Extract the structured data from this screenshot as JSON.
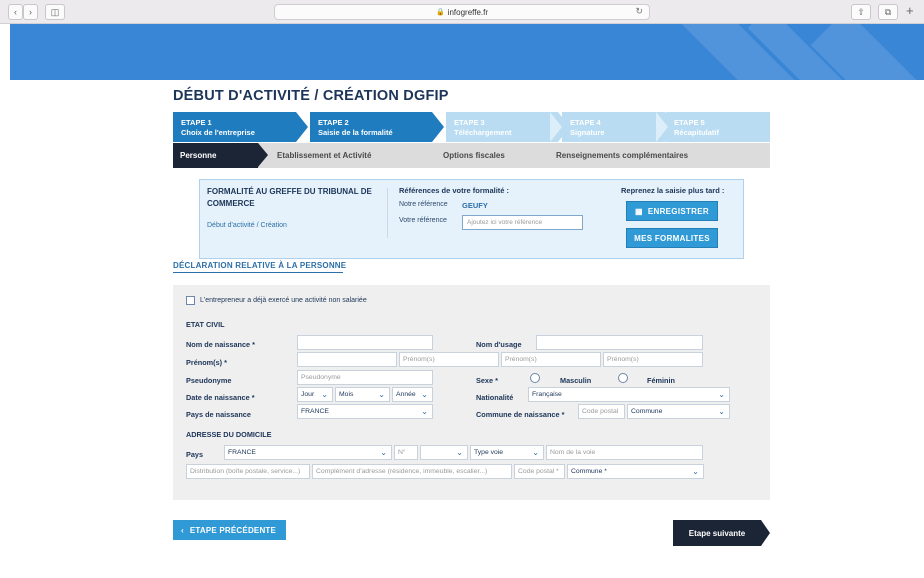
{
  "browser": {
    "url": "infogreffe.fr"
  },
  "page": {
    "title": "DÉBUT D'ACTIVITÉ / CRÉATION DGFIP"
  },
  "steps": [
    {
      "num": "ETAPE 1",
      "label": "Choix de l'entreprise",
      "state": "done"
    },
    {
      "num": "ETAPE 2",
      "label": "Saisie de la formalité",
      "state": "active"
    },
    {
      "num": "ETAPE 3",
      "label": "Téléchargement",
      "state": "todo"
    },
    {
      "num": "ETAPE 4",
      "label": "Signature",
      "state": "todo"
    },
    {
      "num": "ETAPE 5",
      "label": "Récapitulatif",
      "state": "todo"
    }
  ],
  "subtabs": [
    "Personne",
    "Etablissement et Activité",
    "Options fiscales",
    "Renseignements complémentaires"
  ],
  "formality": {
    "title": "FORMALITÉ AU GREFFE DU TRIBUNAL DE COMMERCE",
    "link": "Début d'activité / Création",
    "refs_title": "Références de votre formalité :",
    "our_ref_label": "Notre référence",
    "our_ref_value": "GEUFY",
    "your_ref_label": "Votre référence",
    "your_ref_placeholder": "Ajoutez ici votre référence",
    "resume_label": "Reprenez la saisie plus tard :",
    "save_button": "ENREGISTRER",
    "my_formalities_button": "MES FORMALITES"
  },
  "section": {
    "title": "DÉCLARATION RELATIVE À LA PERSONNE"
  },
  "form": {
    "prior_activity_label": "L'entrepreneur a déjà exercé une activité non salariée",
    "etat_civil": "ETAT CIVIL",
    "nom_naissance": "Nom de naissance *",
    "nom_usage": "Nom d'usage",
    "prenoms": "Prénom(s) *",
    "prenom_placeholder": "Prénom(s)",
    "pseudonyme": "Pseudonyme",
    "pseudonyme_placeholder": "Pseudonyme",
    "sexe": "Sexe *",
    "masculin": "Masculin",
    "feminin": "Féminin",
    "date_naissance": "Date de naissance *",
    "jour": "Jour",
    "mois": "Mois",
    "annee": "Année",
    "nationalite": "Nationalité",
    "nationalite_value": "Française",
    "pays_naissance": "Pays de naissance",
    "pays_naissance_value": "FRANCE",
    "commune_naissance": "Commune de naissance *",
    "code_postal_placeholder": "Code postal",
    "commune_value": "Commune",
    "adresse_domicile": "ADRESSE DU DOMICILE",
    "pays": "Pays",
    "pays_value": "FRANCE",
    "numero_placeholder": "N°",
    "type_voie": "Type voie",
    "nom_voie_placeholder": "Nom de la voie",
    "distribution_placeholder": "Distribution (boîte postale, service...)",
    "complement_placeholder": "Complément d'adresse (résidence, immeuble, escalier...)",
    "code_postal_req_placeholder": "Code postal *",
    "commune_req": "Commune *"
  },
  "nav": {
    "prev": "ETAPE PRÉCÉDENTE",
    "next": "Etape suivante"
  },
  "colors": {
    "accent": "#1f7cbf",
    "dark": "#1c2536",
    "banner": "#3a86d6"
  }
}
